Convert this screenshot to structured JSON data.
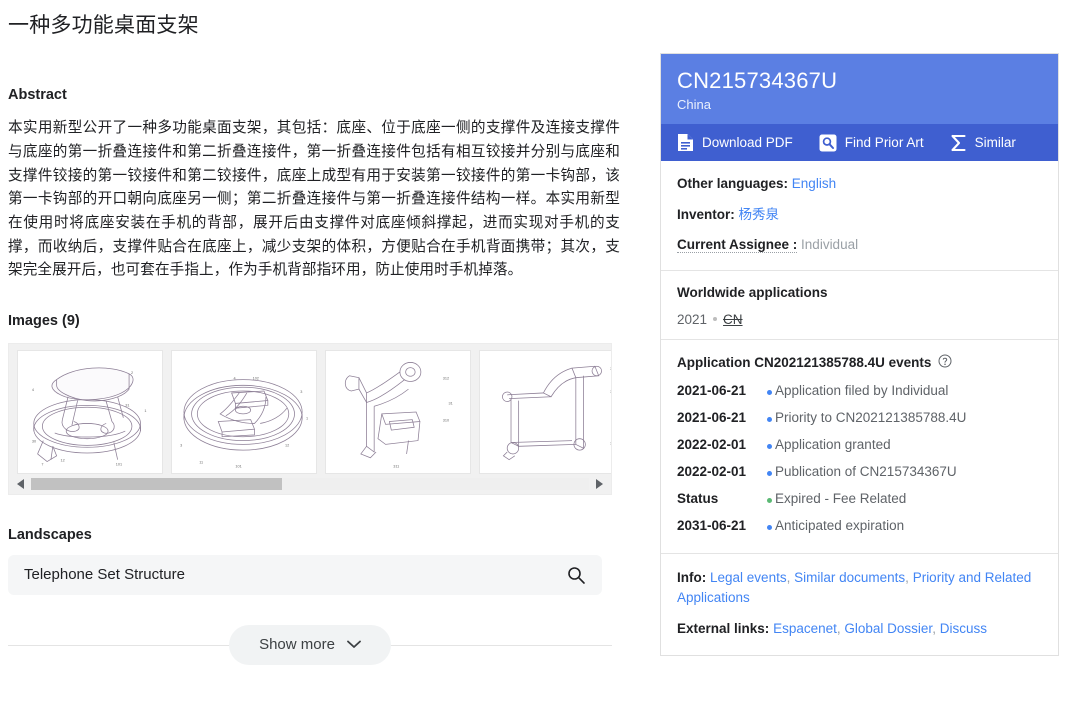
{
  "patent": {
    "title": "一种多功能桌面支架",
    "abstract_heading": "Abstract",
    "abstract_text": "本实用新型公开了一种多功能桌面支架，其包括：底座、位于底座一侧的支撑件及连接支撑件与底座的第一折叠连接件和第二折叠连接件，第一折叠连接件包括有相互铰接并分别与底座和支撑件铰接的第一铰接件和第二铰接件，底座上成型有用于安装第一铰接件的第一卡钩部，该第一卡钩部的开口朝向底座另一侧；第二折叠连接件与第一折叠连接件结构一样。本实用新型在使用时将底座安装在手机的背部，展开后由支撑件对底座倾斜撑起，进而实现对手机的支撑，而收纳后，支撑件贴合在底座上，减少支架的体积，方便贴合在手机背面携带；其次，支架完全展开后，也可套在手指上，作为手机背部指环用，防止使用时手机掉落。"
  },
  "images": {
    "heading": "Images (9)",
    "count": 9,
    "scroll_left_icon": "triangle-left-icon",
    "scroll_right_icon": "triangle-right-icon",
    "thumbnails": [
      {
        "alt": "patent-figure-1"
      },
      {
        "alt": "patent-figure-2"
      },
      {
        "alt": "patent-figure-3"
      },
      {
        "alt": "patent-figure-4"
      }
    ]
  },
  "landscapes": {
    "heading": "Landscapes",
    "items": [
      {
        "label": "Telephone Set Structure",
        "search_icon": "search-icon"
      }
    ]
  },
  "show_more": {
    "label": "Show more",
    "icon": "chevron-down-icon"
  },
  "info_panel": {
    "publication_number": "CN215734367U",
    "country": "China",
    "actions": [
      {
        "label": "Download PDF",
        "icon": "document-icon"
      },
      {
        "label": "Find Prior Art",
        "icon": "prior-art-search-icon"
      },
      {
        "label": "Similar",
        "icon": "sigma-icon"
      }
    ],
    "meta": {
      "other_languages_label": "Other languages:",
      "other_languages_value": "English",
      "inventor_label": "Inventor:",
      "inventor_value": "杨秀泉",
      "assignee_label": "Current Assignee :",
      "assignee_value": "Individual"
    },
    "worldwide": {
      "heading": "Worldwide applications",
      "year": "2021",
      "country_code": "CN"
    },
    "events": {
      "heading": "Application CN202121385788.4U events",
      "help_icon": "help-circle-icon",
      "rows": [
        {
          "date": "2021-06-21",
          "text": "Application filed by Individual",
          "color": "#4285f4"
        },
        {
          "date": "2021-06-21",
          "text": "Priority to CN202121385788.4U",
          "color": "#4285f4"
        },
        {
          "date": "2022-02-01",
          "text": "Application granted",
          "color": "#4285f4"
        },
        {
          "date": "2022-02-01",
          "text": "Publication of CN215734367U",
          "color": "#4285f4"
        },
        {
          "date": "Status",
          "text": "Expired - Fee Related",
          "color": "#5bb974"
        },
        {
          "date": "2031-06-21",
          "text": "Anticipated expiration",
          "color": "#4285f4"
        }
      ]
    },
    "links": {
      "info_label": "Info:",
      "info_links": [
        "Legal events",
        "Similar documents",
        "Priority and Related Applications"
      ],
      "external_label": "External links:",
      "external_links": [
        "Espacenet",
        "Global Dossier",
        "Discuss"
      ]
    }
  },
  "colors": {
    "header_blue": "#5b7fe3",
    "action_bar_blue": "#3f5fd0",
    "link_blue": "#4285f4",
    "status_green": "#5bb974"
  }
}
